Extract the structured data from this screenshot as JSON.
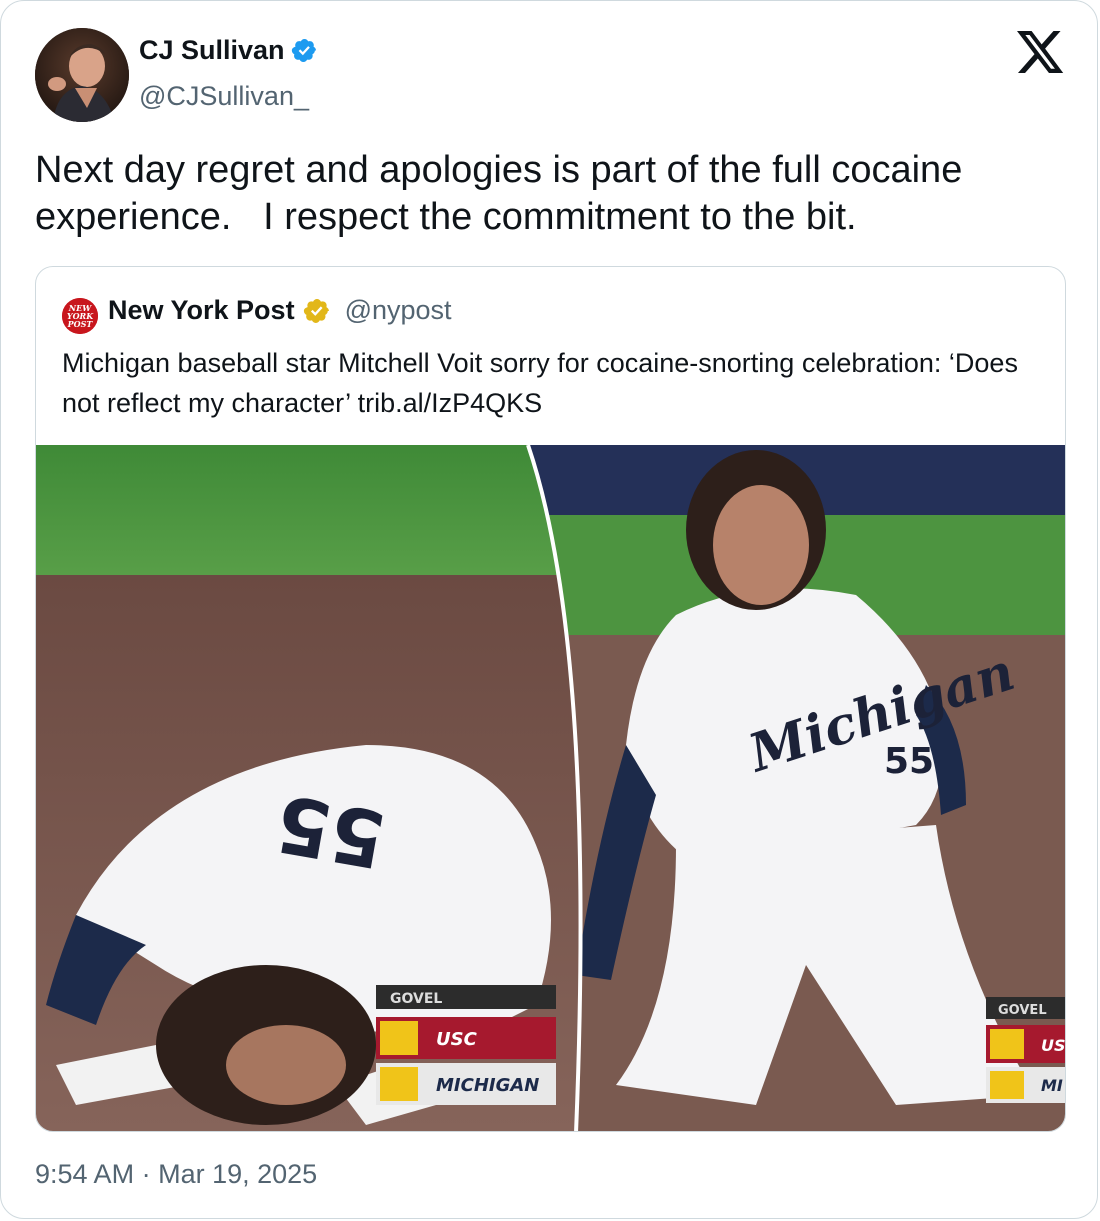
{
  "author": {
    "name": "CJ Sullivan",
    "handle": "@CJSullivan_",
    "verified": true,
    "verified_color": "#1d9bf0",
    "avatar_icon": "profile-photo"
  },
  "platform_icon": "x-logo",
  "tweet": {
    "text": "Next day regret and apologies is part of the full cocaine experience.   I respect the commitment to the bit."
  },
  "quoted_tweet": {
    "author_name": "New York Post",
    "author_handle": "@nypost",
    "logo_text": "NEW YORK POST",
    "verified_badge_color": "#e2b719",
    "text": "Michigan baseball star Mitchell Voit sorry for cocaine-snorting celebration: ‘Does not reflect my character’ trib.al/IzP4QKS",
    "media": {
      "jersey_number": "55",
      "jersey_script": "Michigan",
      "scoreboard": {
        "network": "GOVEL",
        "team1": "USC",
        "team2": "MICHIGAN",
        "team1_short": "US",
        "team2_short": "MI"
      }
    }
  },
  "meta": {
    "time": "9:54 AM",
    "separator": "·",
    "date": "Mar 19, 2025"
  }
}
